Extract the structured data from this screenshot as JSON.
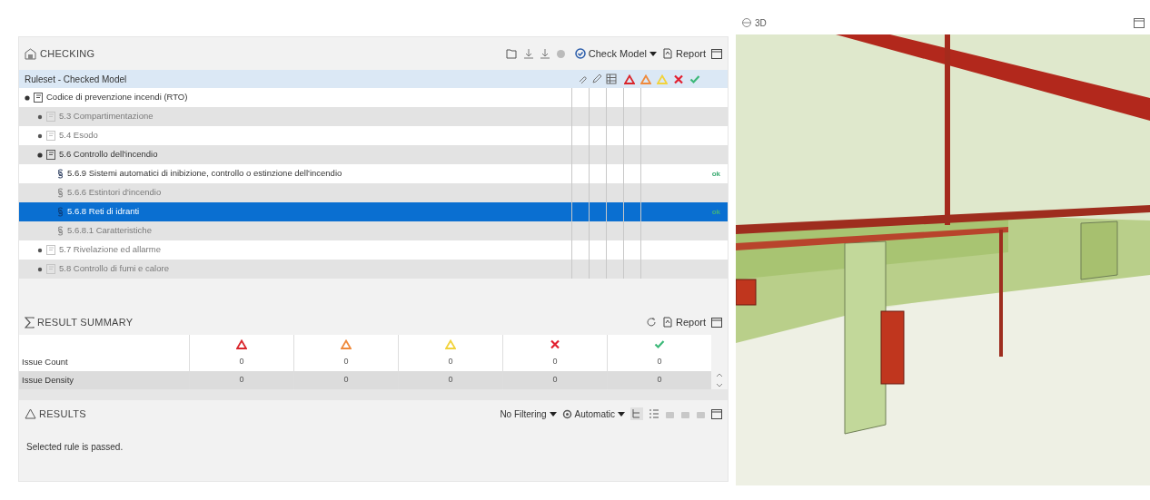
{
  "checking": {
    "title": "CHECKING",
    "toolbar": {
      "check_label": "Check Model",
      "report_label": "Report"
    },
    "tree_header": "Ruleset - Checked Model",
    "tree": [
      {
        "label": "Codice di prevenzione incendi (RTO)",
        "kind": "folder",
        "expanded": true,
        "enabled": true,
        "selected": false,
        "children": [
          {
            "label": "5.3 Compartimentazione",
            "kind": "folder",
            "expanded": false,
            "enabled": false,
            "selected": false
          },
          {
            "label": "5.4 Esodo",
            "kind": "folder",
            "expanded": false,
            "enabled": false,
            "selected": false
          },
          {
            "label": "5.6 Controllo dell'incendio",
            "kind": "folder",
            "expanded": true,
            "enabled": true,
            "selected": false,
            "children": [
              {
                "label": "5.6.9 Sistemi automatici di inibizione, controllo o estinzione dell'incendio",
                "kind": "rule",
                "enabled": true,
                "selected": false,
                "result": "ok"
              },
              {
                "label": "5.6.6 Estintori d'incendio",
                "kind": "rule",
                "enabled": false,
                "selected": false
              },
              {
                "label": "5.6.8 Reti di idranti",
                "kind": "rule",
                "enabled": true,
                "selected": true,
                "result": "ok"
              },
              {
                "label": "5.6.8.1 Caratteristiche",
                "kind": "rule",
                "enabled": false,
                "selected": false
              }
            ]
          },
          {
            "label": "5.7 Rivelazione ed allarme",
            "kind": "folder",
            "expanded": false,
            "enabled": false,
            "selected": false
          },
          {
            "label": "5.8 Controllo di fumi e calore",
            "kind": "folder",
            "expanded": false,
            "enabled": false,
            "selected": false
          }
        ]
      }
    ]
  },
  "result_summary": {
    "title": "RESULT SUMMARY",
    "report_label": "Report",
    "columns": [
      {
        "kind": "critical"
      },
      {
        "kind": "major"
      },
      {
        "kind": "minor"
      },
      {
        "kind": "error"
      },
      {
        "kind": "passed"
      }
    ],
    "rows": [
      {
        "label": "Issue Count",
        "values": [
          "0",
          "0",
          "0",
          "0",
          "0"
        ]
      },
      {
        "label": "Issue Density",
        "values": [
          "0",
          "0",
          "0",
          "0",
          "0"
        ]
      }
    ]
  },
  "results": {
    "title": "RESULTS",
    "filter": "No Filtering",
    "mode": "Automatic",
    "message": "Selected rule is passed."
  },
  "viewer": {
    "title": "3D"
  }
}
